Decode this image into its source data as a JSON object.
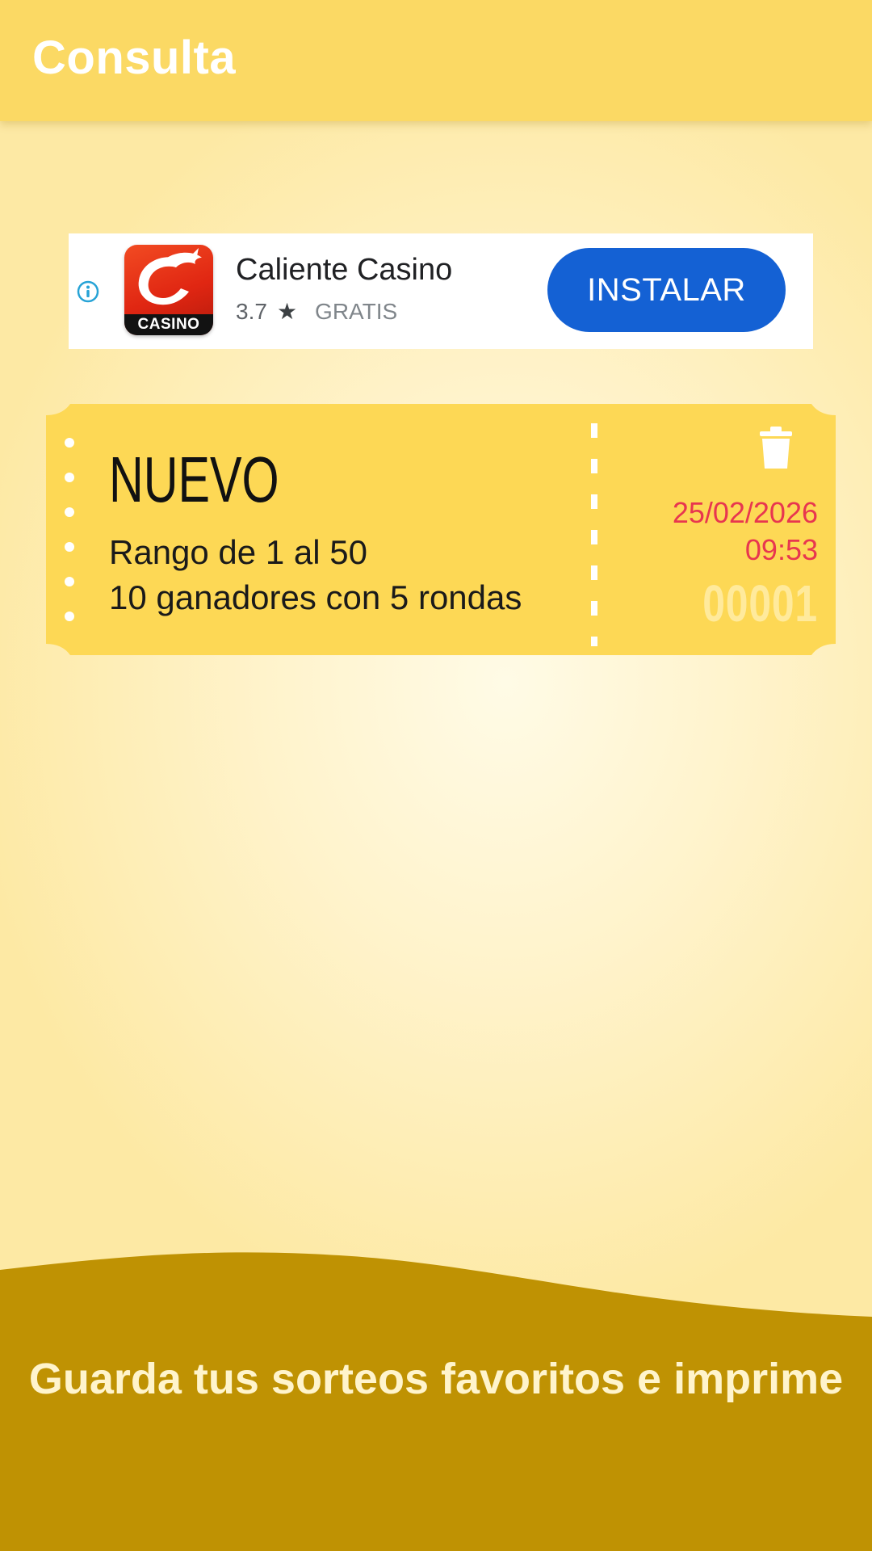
{
  "appbar": {
    "title": "Consulta"
  },
  "ad": {
    "info_icon": "info-circle-icon",
    "app_name": "Caliente Casino",
    "app_icon_label": "CASINO",
    "rating": "3.7",
    "rating_icon": "star-icon",
    "price": "GRATIS",
    "install_label": "INSTALAR",
    "install_color": "#1461d4"
  },
  "ticket": {
    "title": "NUEVO",
    "line1": "Rango de 1 al 50",
    "line2": "10 ganadores con 5 rondas",
    "date": "25/02/2026",
    "time": "09:53",
    "number": "00001",
    "delete_icon": "trash-icon",
    "card_color": "#fdd855",
    "date_color": "#e8364f"
  },
  "footer": {
    "message": "Guarda tus sorteos favoritos e imprime",
    "wave_color": "#bf9203"
  }
}
